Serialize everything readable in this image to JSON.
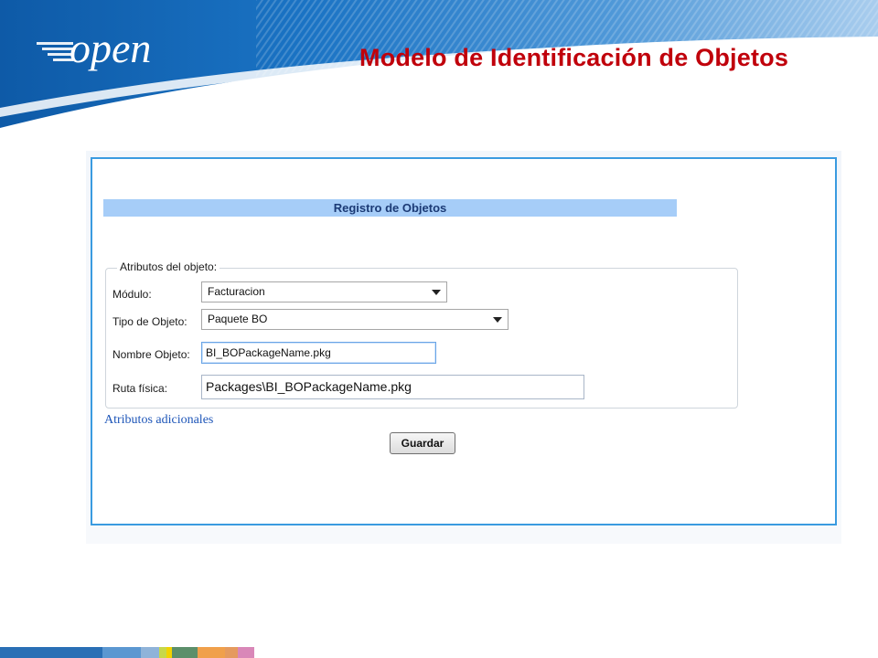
{
  "slide": {
    "title": "Modelo de Identificación de Objetos"
  },
  "logo": {
    "text": "open"
  },
  "form": {
    "header": "Registro de Objetos",
    "fieldset_legend": "Atributos del objeto:",
    "modulo": {
      "label": "Módulo:",
      "value": "Facturacion"
    },
    "tipo_objeto": {
      "label": "Tipo de Objeto:",
      "value": "Paquete BO"
    },
    "nombre_objeto": {
      "label": "Nombre Objeto:",
      "value": "BI_BOPackageName.pkg"
    },
    "ruta_fisica": {
      "label": "Ruta física:",
      "value": "Packages\\BI_BOPackageName.pkg"
    },
    "additional_link": "Atributos adicionales",
    "save_label": "Guardar"
  },
  "colors": {
    "title_red": "#c0000b",
    "frame_blue": "#3a9be0",
    "header_blue": "#a6cdf8",
    "wave_blue": "#1565b6",
    "bottom_bar": [
      "#2a6fb5",
      "#5b97d1",
      "#8fb3d9",
      "#c7d84a",
      "#f2d200",
      "#5c8f6a",
      "#f0a04b",
      "#e59a5e",
      "#d987b8"
    ]
  }
}
